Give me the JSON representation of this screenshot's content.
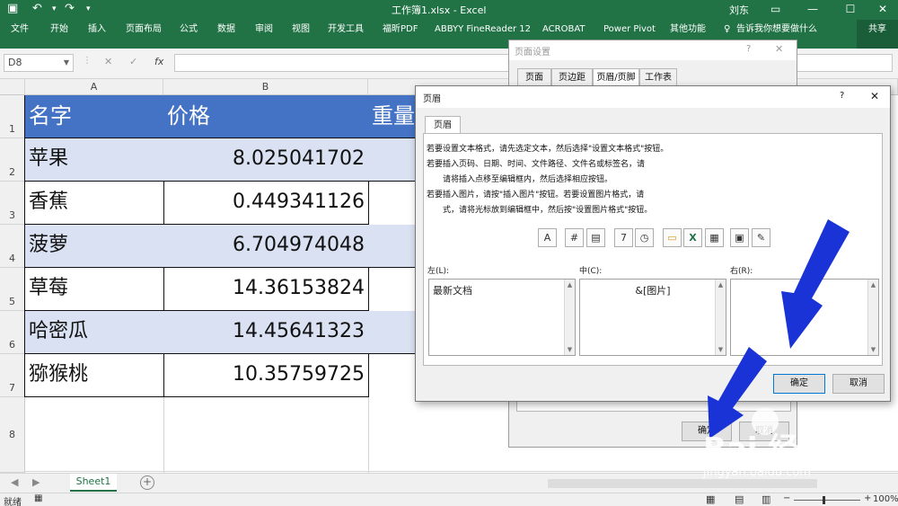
{
  "titlebar": {
    "title": "工作簿1.xlsx  -  Excel",
    "user": "刘东"
  },
  "ribbon": {
    "tabs": [
      "文件",
      "开始",
      "插入",
      "页面布局",
      "公式",
      "数据",
      "审阅",
      "视图",
      "开发工具",
      "福昕PDF",
      "ABBYY FineReader 12",
      "ACROBAT",
      "Power Pivot",
      "其他功能"
    ],
    "tell_me": "告诉我你想要做什么",
    "share": "共享"
  },
  "formula_bar": {
    "name_box": "D8",
    "fx": "fx",
    "cancel": "✕",
    "enter": "✓"
  },
  "columns": [
    "A",
    "B"
  ],
  "rows": [
    "1",
    "2",
    "3",
    "4",
    "5",
    "6",
    "7",
    "8"
  ],
  "table": {
    "headers": [
      "名字",
      "价格",
      "重量"
    ],
    "rows": [
      [
        "苹果",
        "8.025041702"
      ],
      [
        "香蕉",
        "0.449341126"
      ],
      [
        "菠萝",
        "6.704974048"
      ],
      [
        "草莓",
        "14.36153824"
      ],
      [
        "哈密瓜",
        "14.45641323"
      ],
      [
        "猕猴桃",
        "10.35759725"
      ]
    ]
  },
  "sheet_tabs": {
    "active": "Sheet1",
    "add": "+"
  },
  "status": {
    "ready": "就绪",
    "zoom": "100%"
  },
  "page_setup": {
    "title": "页面设置",
    "help": "?",
    "close": "✕",
    "tabs": [
      "页面",
      "页边距",
      "页眉/页脚",
      "工作表"
    ],
    "ok": "确定",
    "cancel": "取消"
  },
  "header_dialog": {
    "title": "页眉",
    "help": "?",
    "close": "✕",
    "tab": "页眉",
    "instructions": [
      "若要设置文本格式，请先选定文本，然后选择\"设置文本格式\"按钮。",
      "若要插入页码、日期、时间、文件路径、文件名或标签名，请",
      "请将插入点移至编辑框内，然后选择相应按钮。",
      "若要插入图片，请按\"插入图片\"按钮。若要设置图片格式，请",
      "式，请将光标放到编辑框中，然后按\"设置图片格式\"按钮。"
    ],
    "left_label": "左(L):",
    "center_label": "中(C):",
    "right_label": "右(R):",
    "left_text": "最新文档",
    "center_text": "&[图片]",
    "right_text": "",
    "ok": "确定",
    "cancel": "取消",
    "toolbar_icons": [
      "A",
      "#",
      "▤",
      "7",
      "◷",
      "▭",
      "X",
      "▦",
      "▣",
      "✎"
    ]
  },
  "watermark": {
    "brand": "Bai 经验",
    "url": "jingyan.baidu.com"
  },
  "colors": {
    "excel_green": "#217346",
    "table_header": "#4472c4",
    "band": "#d9e1f2",
    "arrow": "#1a33d6"
  }
}
